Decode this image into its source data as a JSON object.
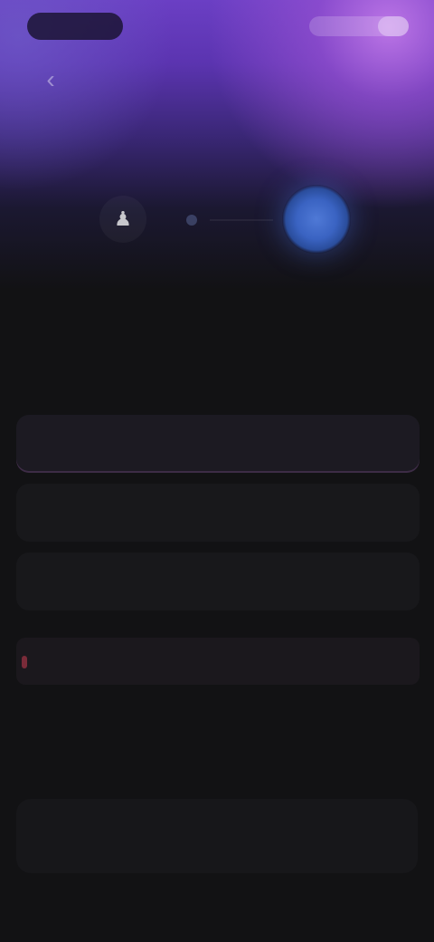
{
  "header": {
    "back_icon": "chevron-left-icon",
    "title": ""
  },
  "stepper": {
    "completed_icon": "person-icon",
    "step_count": 2,
    "active_step": 2
  },
  "question": "",
  "fields": [
    {
      "placeholder": ""
    },
    {
      "placeholder": ""
    },
    {
      "placeholder": ""
    }
  ],
  "note": "",
  "cta": {
    "label": ""
  },
  "colors": {
    "accent_purple": "#6b3fc4",
    "accent_blue": "#3a63c2",
    "background": "#121214",
    "note_marker": "#c83c50"
  }
}
